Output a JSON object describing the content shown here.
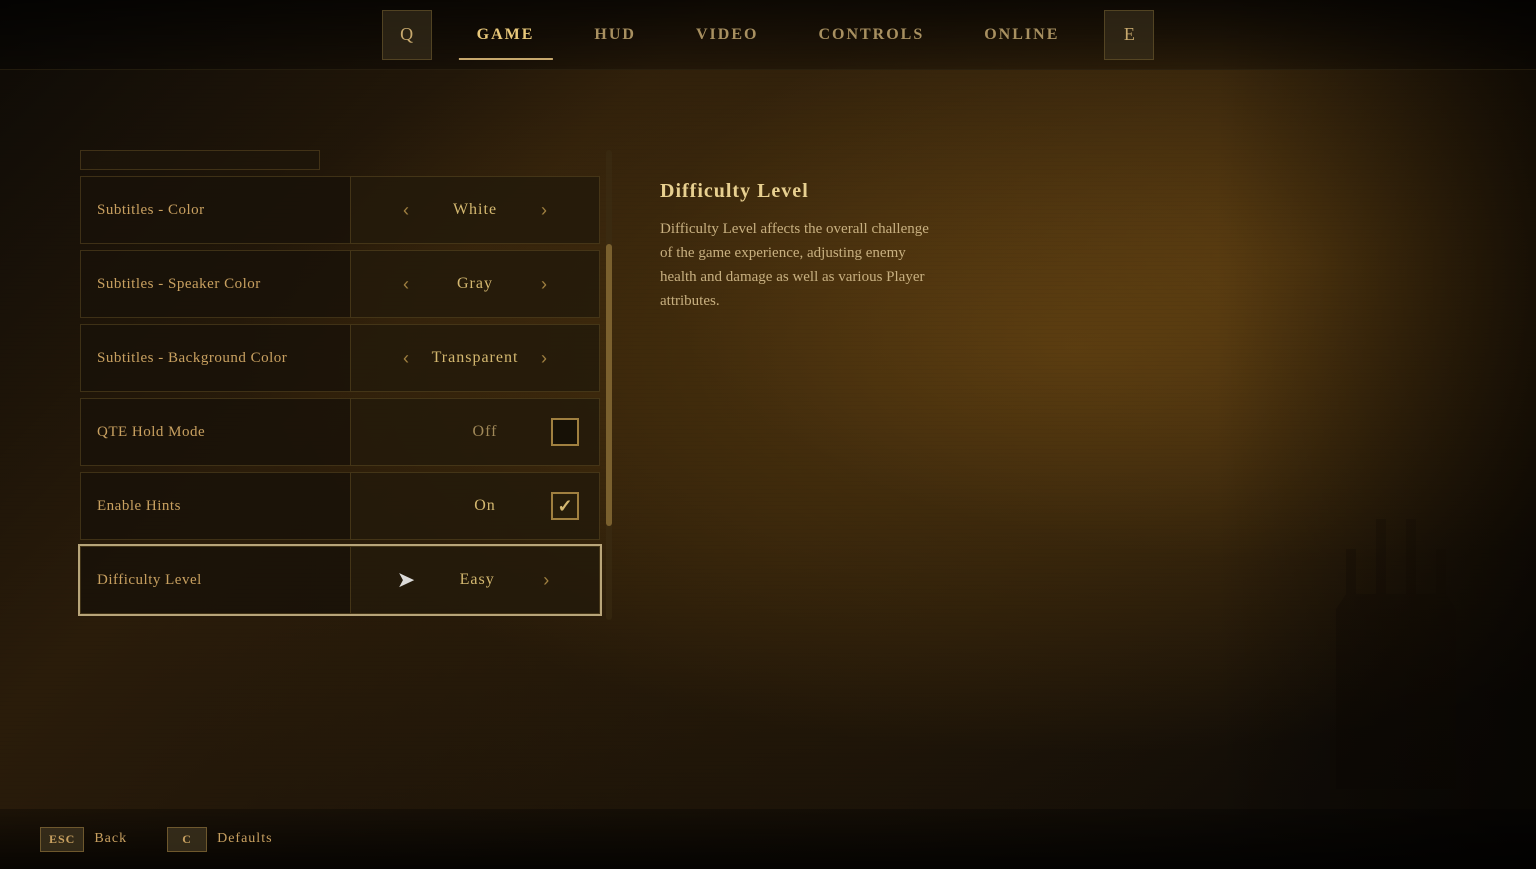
{
  "nav": {
    "tabs": [
      {
        "id": "game",
        "label": "GAME",
        "active": true
      },
      {
        "id": "hud",
        "label": "HUD",
        "active": false
      },
      {
        "id": "video",
        "label": "VIDEO",
        "active": false
      },
      {
        "id": "controls",
        "label": "CONTROLS",
        "active": false
      },
      {
        "id": "online",
        "label": "ONLINE",
        "active": false
      }
    ],
    "left_icon": "Q",
    "right_icon": "E"
  },
  "settings": {
    "rows": [
      {
        "id": "subtitles-color",
        "label": "Subtitles - Color",
        "control_type": "selector",
        "value": "White",
        "selected": false
      },
      {
        "id": "subtitles-speaker-color",
        "label": "Subtitles - Speaker Color",
        "control_type": "selector",
        "value": "Gray",
        "selected": false
      },
      {
        "id": "subtitles-background-color",
        "label": "Subtitles - Background Color",
        "control_type": "selector",
        "value": "Transparent",
        "selected": false
      },
      {
        "id": "qte-hold-mode",
        "label": "QTE Hold Mode",
        "control_type": "checkbox",
        "value": "Off",
        "checked": false,
        "selected": false
      },
      {
        "id": "enable-hints",
        "label": "Enable Hints",
        "control_type": "checkbox",
        "value": "On",
        "checked": true,
        "selected": false
      },
      {
        "id": "difficulty-level",
        "label": "Difficulty Level",
        "control_type": "selector",
        "value": "Easy",
        "selected": true
      }
    ]
  },
  "info_panel": {
    "title": "Difficulty Level",
    "description": "Difficulty Level affects the overall challenge of the game experience, adjusting enemy health and damage as well as various Player attributes."
  },
  "bottom_bar": {
    "actions": [
      {
        "key": "ESC",
        "label": "Back"
      },
      {
        "key": "C",
        "label": "Defaults"
      }
    ]
  }
}
